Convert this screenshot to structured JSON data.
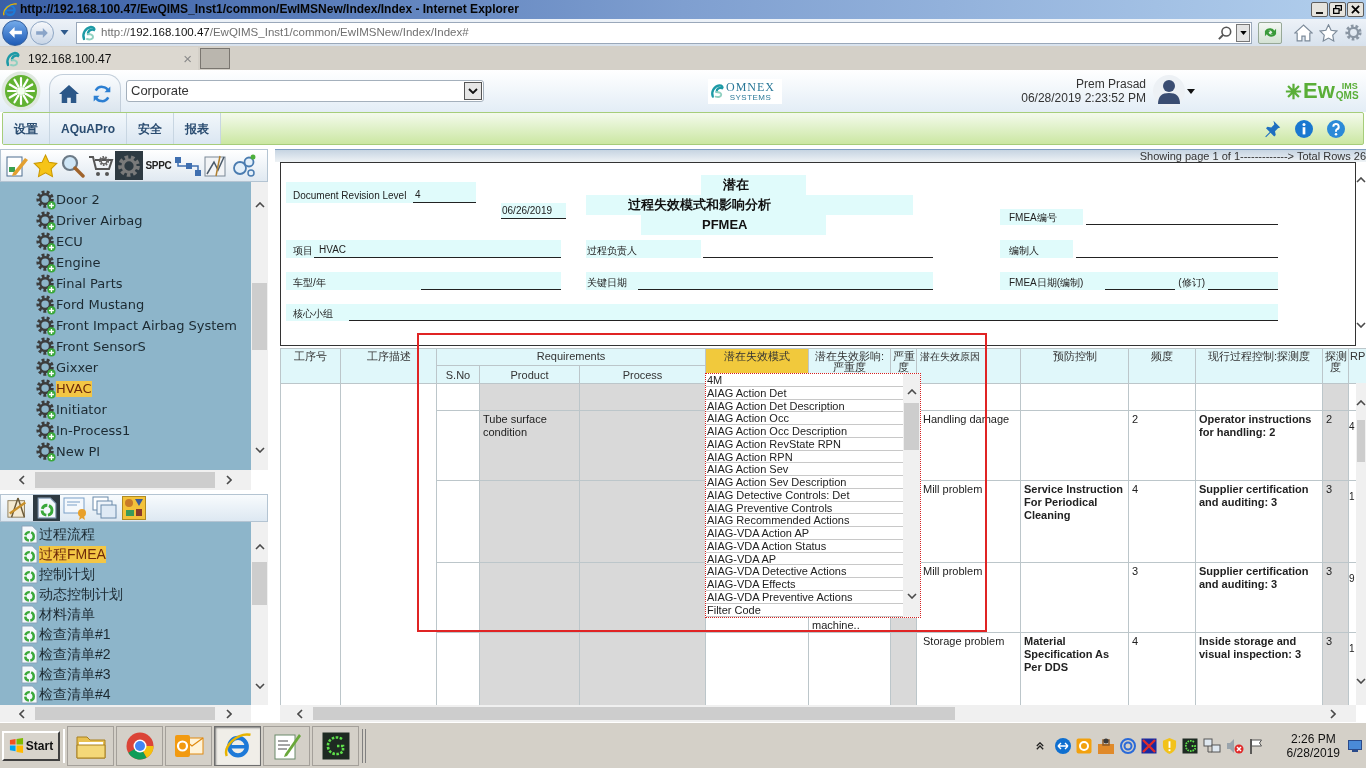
{
  "browser": {
    "title": "http://192.168.100.47/EwQIMS_Inst1/common/EwIMSNew/Index/Index - Internet Explorer",
    "address": {
      "scheme": "http://",
      "host": "192.168.100.47",
      "path": "/EwQIMS_Inst1/common/EwIMSNew/Index/Index#"
    },
    "tabs": [
      {
        "label": "192.168.100.47",
        "close": "×",
        "selected": true
      }
    ]
  },
  "header": {
    "site": "Corporate",
    "brand": {
      "name": "OMNEX",
      "tagline": "SYSTEMS"
    },
    "user": {
      "name": "Prem Prasad",
      "datetime": "06/28/2019 2:23:52 PM"
    },
    "product_logo": {
      "main": "Ew",
      "upper": "IMS",
      "lower": "QMS"
    }
  },
  "menu": [
    "设置",
    "AQuAPro",
    "安全",
    "报表"
  ],
  "left_panel": {
    "module_tools": [
      {
        "selected": false
      },
      {
        "selected": false
      },
      {
        "selected": false
      },
      {
        "selected": false
      },
      {
        "selected": true
      },
      {
        "label": "SPPC",
        "selected": false
      },
      {
        "selected": false
      },
      {
        "selected": false
      },
      {
        "selected": false
      }
    ],
    "tree": [
      {
        "label": "Door 2",
        "selected": false
      },
      {
        "label": "Driver Airbag",
        "selected": false
      },
      {
        "label": "ECU",
        "selected": false
      },
      {
        "label": "Engine",
        "selected": false
      },
      {
        "label": "Final Parts",
        "selected": false
      },
      {
        "label": "Ford Mustang",
        "selected": false
      },
      {
        "label": "Front Impact Airbag System",
        "selected": false
      },
      {
        "label": "Front SensorS",
        "selected": false
      },
      {
        "label": "Gixxer",
        "selected": false
      },
      {
        "label": "HVAC",
        "selected": true
      },
      {
        "label": "Initiator",
        "selected": false
      },
      {
        "label": "In-Process1",
        "selected": false
      },
      {
        "label": "New PI",
        "selected": false
      }
    ],
    "doc_tools": [
      {
        "selected": false
      },
      {
        "selected": true
      },
      {
        "selected": false
      },
      {
        "selected": false
      },
      {
        "selected": false
      }
    ],
    "documents": [
      {
        "label": "过程流程",
        "selected": false
      },
      {
        "label": "过程FMEA",
        "selected": true
      },
      {
        "label": "控制计划",
        "selected": false
      },
      {
        "label": "动态控制计划",
        "selected": false
      },
      {
        "label": "材料清单",
        "selected": false
      },
      {
        "label": "检查清单#1",
        "selected": false
      },
      {
        "label": "检查清单#2",
        "selected": false
      },
      {
        "label": "检查清单#3",
        "selected": false
      },
      {
        "label": "检查清单#4",
        "selected": false
      }
    ]
  },
  "page_info": "Showing page 1 of 1-------------> Total Rows 26",
  "form": {
    "revision": {
      "label": "Document Revision Level",
      "value": "4"
    },
    "date": {
      "value": "06/26/2019"
    },
    "title": [
      "潜在",
      "过程失效模式和影响分析",
      "PFMEA"
    ],
    "fmea_number": {
      "label": "FMEA编号"
    },
    "project": {
      "label": "项目",
      "value": "HVAC"
    },
    "process_owner": {
      "label": "过程负责人"
    },
    "prepared_by": {
      "label": "编制人"
    },
    "model_year": {
      "label": "车型/年"
    },
    "key_date": {
      "label": "关键日期"
    },
    "fmea_date": {
      "label": "FMEA日期(编制)",
      "revision_label": "(修订)"
    },
    "core_team": {
      "label": "核心小组"
    }
  },
  "table": {
    "columns": [
      {
        "label": "工序号",
        "selected": false
      },
      {
        "label": "工序描述",
        "selected": false
      },
      {
        "label": "Requirements",
        "selected": false,
        "children": [
          {
            "label": "S.No"
          },
          {
            "label": "Product"
          },
          {
            "label": "Process"
          }
        ]
      },
      {
        "label": "潜在失效模式",
        "selected": true
      },
      {
        "label": "潜在失效影响:严重度",
        "selected": false
      },
      {
        "label": "严重度",
        "selected": false
      },
      {
        "label": "潜在失效原因",
        "selected": false
      },
      {
        "label": "预防控制",
        "selected": false
      },
      {
        "label": "频度",
        "selected": false
      },
      {
        "label": "现行过程控制:探测度",
        "selected": false
      },
      {
        "label": "探测度",
        "selected": false
      },
      {
        "label": "RP",
        "selected": false
      }
    ],
    "rows": [
      {},
      {
        "product": "Tube surface condition",
        "cause": "Handling damage",
        "occurrence": "2",
        "detection_control": "Operator instructions for handling: 2",
        "detection": "2",
        "rp": "4"
      },
      {
        "cause": "Mill problem",
        "prevention": "Service Instruction For Periodical Cleaning",
        "occurrence": "4",
        "detection_control": "Supplier certification and auditing: 3",
        "detection": "3",
        "rp": "1"
      },
      {
        "effect": "machine..",
        "cause": "Mill problem",
        "occurrence": "3",
        "detection_control": "Supplier certification and auditing: 3",
        "detection": "3",
        "rp": "9"
      },
      {
        "cause": "Storage problem",
        "prevention": "Material Specification As Per DDS",
        "occurrence": "4",
        "detection_control": "Inside storage and visual inspection: 3",
        "detection": "3",
        "rp": "1"
      }
    ]
  },
  "picker": {
    "options": [
      "4M",
      "AIAG Action Det",
      "AIAG Action Det Description",
      "AIAG Action Occ",
      "AIAG Action Occ Description",
      "AIAG Action RevState RPN",
      "AIAG Action RPN",
      "AIAG Action Sev",
      "AIAG Action Sev Description",
      "AIAG Detective Controls: Det",
      "AIAG Preventive Controls",
      "AIAG Recommended Actions",
      "AIAG-VDA Action AP",
      "AIAG-VDA Action Status",
      "AIAG-VDA AP",
      "AIAG-VDA Detective Actions",
      "AIAG-VDA Effects",
      "AIAG-VDA Preventive Actions",
      "Filter Code"
    ]
  },
  "taskbar": {
    "start": "Start",
    "apps": [
      {
        "selected": false
      },
      {
        "selected": false
      },
      {
        "selected": false
      },
      {
        "selected": true
      },
      {
        "selected": false
      },
      {
        "selected": false
      }
    ],
    "clock": {
      "time": "2:26 PM",
      "date": "6/28/2019"
    }
  }
}
